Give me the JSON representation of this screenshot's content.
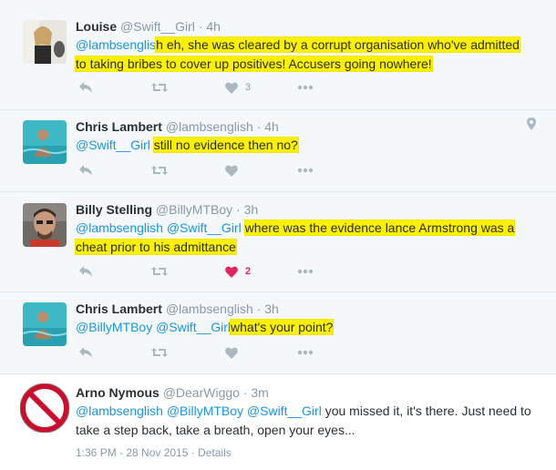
{
  "tweets": [
    {
      "name": "Louise",
      "handle": "@Swift__Girl",
      "dot": "·",
      "time": "4h",
      "text_pre": "@lambsenglis",
      "text_hl": "h eh, she was cleared by a corrupt organisation who've admitted",
      "text_hl2": "to taking bribes to cover up positives! Accusers going nowhere!",
      "like_count": "3"
    },
    {
      "name": "Chris Lambert",
      "handle": "@lambsenglish",
      "dot": "·",
      "time": "4h",
      "mention": "@Swift__Girl",
      "text_hl": "still no evidence then no?"
    },
    {
      "name": "Billy Stelling",
      "handle": "@BillyMTBoy",
      "dot": "·",
      "time": "3h",
      "mention1": "@lambsenglish",
      "mention2": "@Swift__Girl",
      "text_hl": "where was the evidence lance Armstrong was a",
      "text_hl2": "cheat prior to his admittance",
      "like_count": "2"
    },
    {
      "name": "Chris Lambert",
      "handle": "@lambsenglish",
      "dot": "·",
      "time": "3h",
      "mention1": "@BillyMTBoy",
      "mention2": "@Swift__Girl",
      "text_hl": "what's your point?"
    },
    {
      "name": "Arno Nymous",
      "handle": "@DearWiggo",
      "dot": "·",
      "time": "3m",
      "mention1": "@lambsenglish",
      "mention2": "@BillyMTBoy",
      "mention3": "@Swift__Girl",
      "text_line1": " you missed it, it's there. Just need to",
      "text_line2": "take a step back, take a breath, open your eyes...",
      "timestamp": "1:36 PM - 28 Nov 2015",
      "sep": " · ",
      "details": "Details"
    }
  ],
  "colors": {
    "highlight": "#fbf000",
    "mention": "#1b95e0",
    "like_active": "#e0245e",
    "icon": "#aab8c2"
  },
  "icons": [
    "reply-icon",
    "retweet-icon",
    "heart-icon",
    "more-icon",
    "location-icon",
    "blocked-icon"
  ]
}
